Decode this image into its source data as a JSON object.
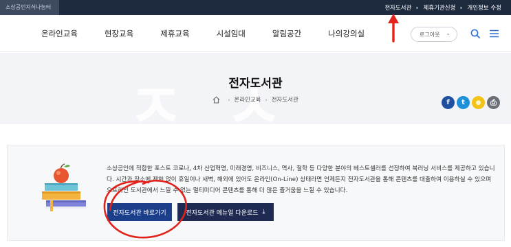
{
  "topbar": {
    "site_name": "소상공인지식나눔터",
    "links": [
      "전자도서관",
      "제휴기관신청",
      "개인정보 수정"
    ]
  },
  "header": {
    "nav": [
      "온라인교육",
      "현장교육",
      "제휴교육",
      "시설임대",
      "알림공간",
      "나의강의실"
    ],
    "logout_label": "로그아웃"
  },
  "hero": {
    "title": "전자도서관",
    "breadcrumb": [
      "온라인교육",
      "전자도서관"
    ]
  },
  "share": {
    "facebook_glyph": "f",
    "twitter_glyph": "t",
    "talk_glyph": "●",
    "print_glyph": "⎙"
  },
  "content": {
    "description": "소상공인에 적합한 포스트 코로나, 4차 산업혁명, 미래경영, 비즈니스, 역사, 철학 등 다양한 분야의 베스트셀러를 선정하여 북러닝 서비스를 제공하고 있습니다. 시간과 장소에 제한 없이 휴일이나 새벽, 해외에 있어도 온라인(On-Line) 상태라면 언제든지 전자도서관을 통해 콘텐츠를 대출하여 이용하실 수 있으며 오프라인 도서관에서 느낄 수 없는 멀티미디어 콘텐츠를 통해 더 많은 즐거움을 느낄 수 있습니다.",
    "primary_button": "전자도서관 바로가기",
    "secondary_button": "전자도서관 메뉴얼 다운로드"
  },
  "colors": {
    "topbar_bg": "#1e2a3e",
    "primary_button": "#1c3f8c",
    "secondary_button": "#1f2a52",
    "annotation": "#e3221b",
    "facebook": "#1f4f9e",
    "twitter": "#1e8fd9",
    "talk": "#f4c316",
    "print": "#6b6f76"
  }
}
